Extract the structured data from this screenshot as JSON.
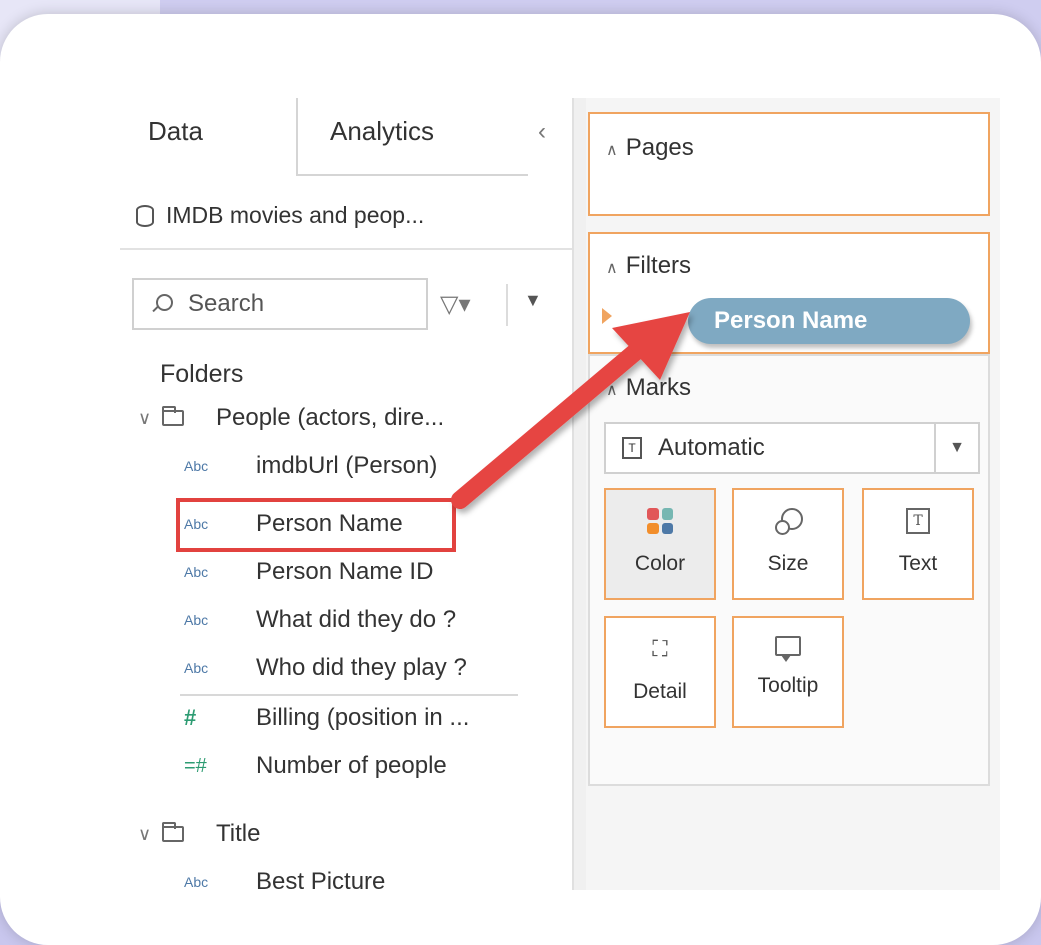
{
  "data_pane": {
    "tabs": [
      "Data",
      "Analytics"
    ],
    "collapse_glyph": "‹",
    "datasource": "IMDB movies and peop...",
    "search_placeholder": "Search",
    "filter_glyph": "▽▾",
    "menu_glyph": "▼",
    "folders_title": "Folders",
    "folders": [
      {
        "name": "People (actors, dire...",
        "fields": [
          {
            "type": "Abc",
            "name": "imdbUrl (Person)"
          },
          {
            "type": "Abc",
            "name": "Person Name"
          },
          {
            "type": "Abc",
            "name": "Person Name ID"
          },
          {
            "type": "Abc",
            "name": "What did they do ?"
          },
          {
            "type": "Abc",
            "name": "Who did they play ?"
          },
          {
            "type": "#",
            "name": "Billing (position in ..."
          },
          {
            "type": "=#",
            "name": "Number of people"
          }
        ]
      },
      {
        "name": "Title",
        "fields": [
          {
            "type": "Abc",
            "name": "Best Picture"
          }
        ]
      }
    ]
  },
  "shelves": {
    "pages_title": "Pages",
    "filters_title": "Filters",
    "filter_pill": "Person Name",
    "marks_title": "Marks",
    "mark_type": "Automatic",
    "mark_buttons": [
      "Color",
      "Size",
      "Text",
      "Detail",
      "Tooltip"
    ]
  },
  "colors": {
    "highlight": "#e2423f",
    "pill": "#7fa9c2",
    "shelf_border": "#f0a460",
    "background": "#c9c7ee"
  },
  "icons": [
    "database-icon",
    "search-icon",
    "filter-icon",
    "folder-icon",
    "color-icon",
    "size-icon",
    "text-icon",
    "detail-icon",
    "tooltip-icon"
  ]
}
